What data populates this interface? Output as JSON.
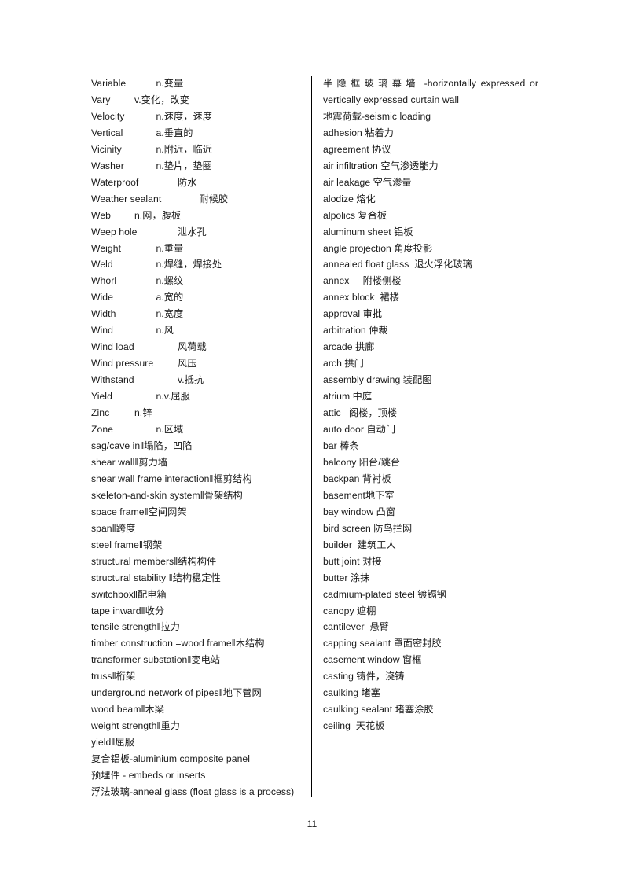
{
  "document": {
    "page_number": "11",
    "text_color": "#1a1a1a",
    "background_color": "#ffffff",
    "divider_color": "#000000"
  },
  "left_column": {
    "entries": [
      "Variable\t\tn.变量",
      "Vary\t\tv.变化，改变",
      "Velocity\t\tn.速度，速度",
      "Vertical\t\ta.垂直的",
      "Vicinity\t\tn.附近，临近",
      "Washer\t\tn.垫片，垫圈",
      "Waterproof\t\t防水",
      "Weather sealant\t\t耐候胶",
      "Web\t\tn.网，腹板",
      "Weep hole\t\t泄水孔",
      "Weight\t\tn.重量",
      "Weld\t\tn.焊缝，焊接处",
      "Whorl\t\tn.螺纹",
      "Wide\t\ta.宽的",
      "Width\t\tn.宽度",
      "Wind\t\tn.风",
      "Wind load\t\t风荷载",
      "Wind pressure\t\t风压",
      "Withstand\t\tv.抵抗",
      "Yield\t\tn.v.屈服",
      "Zinc\t\tn.锌",
      "Zone\t\tn.区域",
      "sag/cave in‖塌陷，凹陷",
      "shear wall‖剪力墙",
      "shear wall frame interaction‖框剪结构",
      "skeleton-and-skin system‖骨架结构",
      "space frame‖空间网架",
      "span‖跨度",
      "steel frame‖钢架",
      "structural members‖结构构件",
      "structural stability ‖结构稳定性",
      "switchbox‖配电箱",
      "tape inward‖收分",
      "tensile strength‖拉力",
      "timber construction =wood frame‖木结构",
      "transformer substation‖变电站",
      "truss‖桁架",
      "underground network of pipes‖地下管网",
      "wood beam‖木梁",
      "weight strength‖重力",
      "yield‖屈服",
      "复合铝板-aluminium composite panel",
      "预埋件 - embeds or inserts",
      "浮法玻璃-anneal glass (float glass is a process)"
    ]
  },
  "right_column": {
    "first_entry": {
      "cjk_part": "半隐框玻璃幕墙",
      "latin_part": " -horizontally expressed or vertically expressed curtain wall"
    },
    "entries": [
      "地震荷载-seismic loading",
      "adhesion 粘着力",
      "agreement 协议",
      "air infiltration 空气渗透能力",
      "air leakage 空气渗量",
      "alodize 熔化",
      "alpolics 复合板",
      "aluminum sheet 铝板",
      "angle projection 角度投影",
      "annealed float glass  退火浮化玻璃",
      "annex     附楼侧楼",
      "annex block  裙楼",
      "approval 审批",
      "arbitration 仲裁",
      "arcade 拱廊",
      "arch 拱门",
      "assembly drawing 装配图",
      "atrium 中庭",
      "attic   阁楼，顶楼",
      "auto door 自动门",
      "bar 棒条",
      "balcony 阳台/跳台",
      "backpan 背衬板",
      "basement地下室",
      "bay window 凸窗",
      "bird screen 防鸟拦网",
      "builder  建筑工人",
      "butt joint 对接",
      "butter 涂抹",
      "cadmium-plated steel 镀镉钢",
      "canopy 遮棚",
      "cantilever  悬臂",
      "capping sealant 罩面密封胶",
      "casement window 窗框",
      "casting 铸件，浇铸",
      "caulking 堵塞",
      "caulking sealant 堵塞涂胶",
      "ceiling  天花板"
    ]
  }
}
